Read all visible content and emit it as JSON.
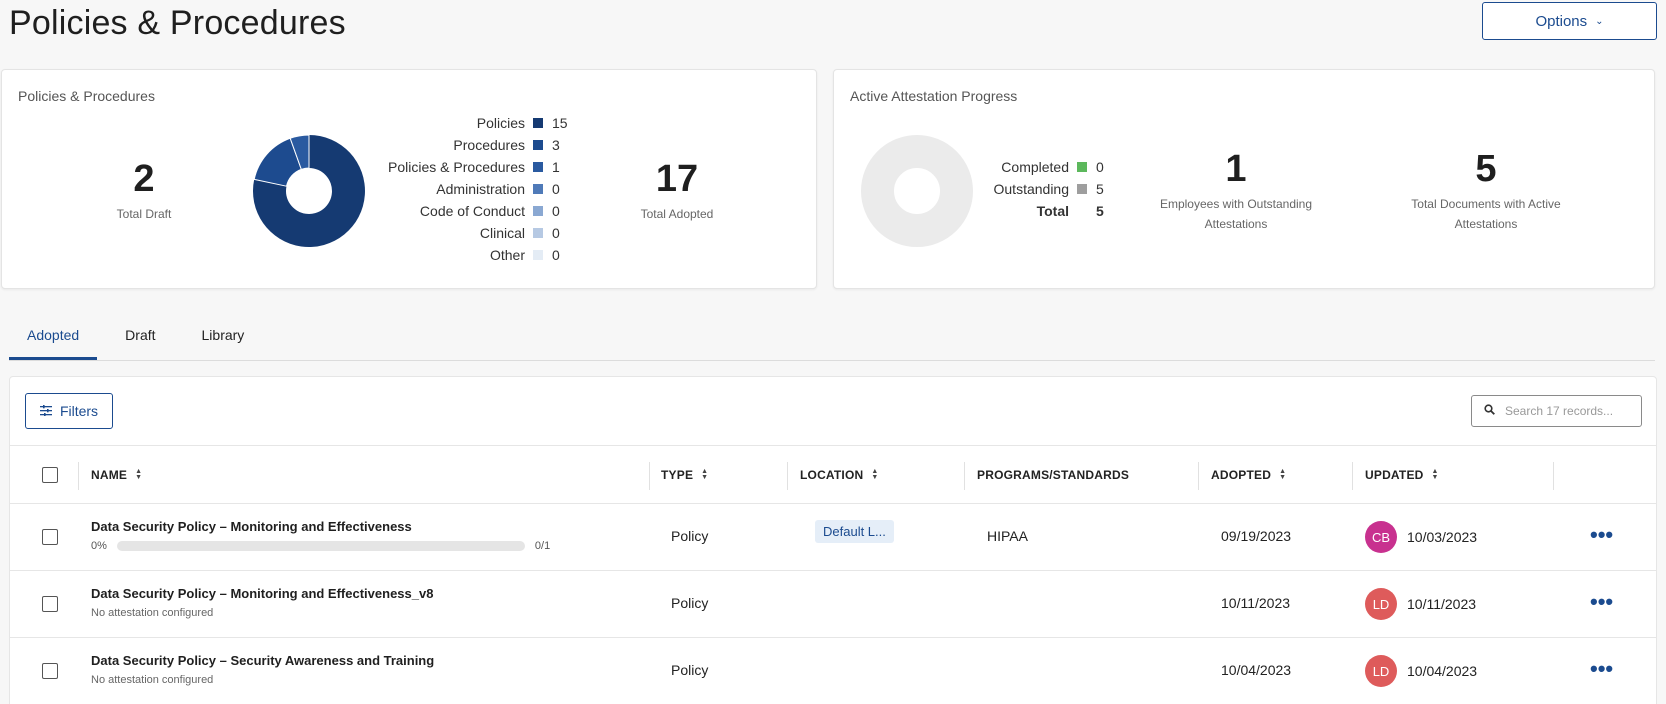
{
  "page": {
    "title": "Policies & Procedures",
    "options_label": "Options"
  },
  "left_card": {
    "title": "Policies & Procedures",
    "total_draft_value": "2",
    "total_draft_label": "Total Draft",
    "total_adopted_value": "17",
    "total_adopted_label": "Total Adopted",
    "legend": [
      {
        "name": "Policies",
        "value": "15",
        "color": "#153a72"
      },
      {
        "name": "Procedures",
        "value": "3",
        "color": "#1d4b8f"
      },
      {
        "name": "Policies & Procedures",
        "value": "1",
        "color": "#2a5aa0"
      },
      {
        "name": "Administration",
        "value": "0",
        "color": "#4f7ab8"
      },
      {
        "name": "Code of Conduct",
        "value": "0",
        "color": "#8aa8d2"
      },
      {
        "name": "Clinical",
        "value": "0",
        "color": "#b6c9e3"
      },
      {
        "name": "Other",
        "value": "0",
        "color": "#e4ecf5"
      }
    ]
  },
  "right_card": {
    "title": "Active Attestation Progress",
    "legend": [
      {
        "name": "Completed",
        "value": "0",
        "color": "#5cb85c"
      },
      {
        "name": "Outstanding",
        "value": "5",
        "color": "#9e9e9e"
      }
    ],
    "total_label": "Total",
    "total_value": "5",
    "employees_value": "1",
    "employees_label": "Employees with Outstanding Attestations",
    "documents_value": "5",
    "documents_label": "Total Documents with Active Attestations"
  },
  "tabs": [
    {
      "label": "Adopted",
      "active": true
    },
    {
      "label": "Draft",
      "active": false
    },
    {
      "label": "Library",
      "active": false
    }
  ],
  "toolbar": {
    "filters_label": "Filters",
    "search_placeholder": "Search 17 records..."
  },
  "columns": {
    "name": "NAME",
    "type": "TYPE",
    "location": "LOCATION",
    "programs": "PROGRAMS/STANDARDS",
    "adopted": "ADOPTED",
    "updated": "UPDATED"
  },
  "rows": [
    {
      "name": "Data Security Policy – Monitoring and Effectiveness",
      "progress_pct": "0%",
      "progress_fraction": 0,
      "progress_count": "0/1",
      "sub": "",
      "type": "Policy",
      "location": "Default L...",
      "programs": "HIPAA",
      "adopted": "09/19/2023",
      "avatar_initials": "CB",
      "avatar_color": "#c8318f",
      "updated": "10/03/2023"
    },
    {
      "name": "Data Security Policy – Monitoring and Effectiveness_v8",
      "sub": "No attestation configured",
      "type": "Policy",
      "location": "",
      "programs": "",
      "adopted": "10/11/2023",
      "avatar_initials": "LD",
      "avatar_color": "#de5b5b",
      "updated": "10/11/2023"
    },
    {
      "name": "Data Security Policy – Security Awareness and Training",
      "sub": "No attestation configured",
      "type": "Policy",
      "location": "",
      "programs": "",
      "adopted": "10/04/2023",
      "avatar_initials": "LD",
      "avatar_color": "#de5b5b",
      "updated": "10/04/2023"
    }
  ]
}
